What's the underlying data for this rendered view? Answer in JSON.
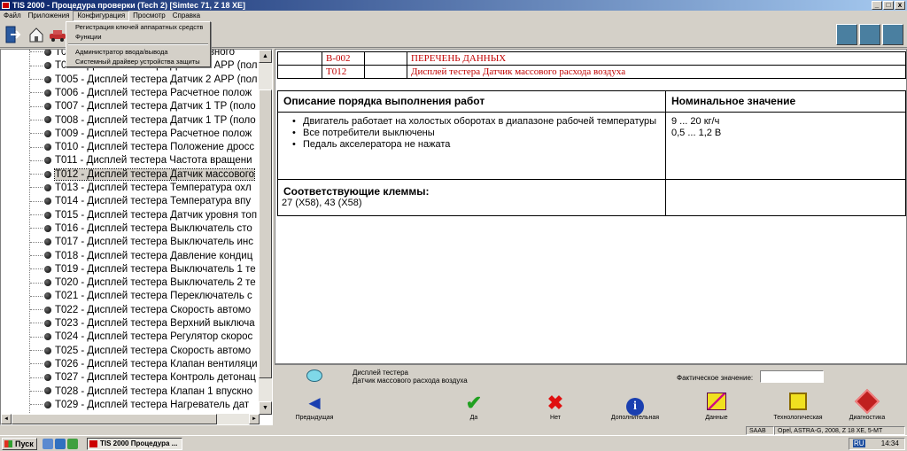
{
  "window": {
    "title": "TIS 2000 - Процедура проверки (Tech 2) [Simtec 71, Z 18 XE]",
    "buttons": [
      "_",
      "□",
      "x"
    ]
  },
  "menu": {
    "items": [
      "Файл",
      "Приложения",
      "Конфигурация",
      "Просмотр",
      "Справка"
    ],
    "open_menu": "Конфигурация",
    "dropdown": {
      "group1": [
        "Регистрация ключей аппаратных средств",
        "Функции"
      ],
      "group2": [
        "Администратор ввода/вывода",
        "Системный драйвер устройства защиты"
      ]
    }
  },
  "tree": {
    "items": [
      "T00... - Дисплей тестера ...топливного",
      "T004 - Дисплей тестера Датчик 1 APP (пол",
      "T005 - Дисплей тестера Датчик 2 APP (пол",
      "T006 - Дисплей тестера Расчетное полож",
      "T007 - Дисплей тестера Датчик 1 TP (поло",
      "T008 - Дисплей тестера Датчик 1 TP (поло",
      "T009 - Дисплей тестера Расчетное полож",
      "T010 - Дисплей тестера Положение дросс",
      "T011 - Дисплей тестера Частота вращени",
      "T012 - Дисплей тестера Датчик массового",
      "T013 - Дисплей тестера Температура охл",
      "T014 - Дисплей тестера Температура впу",
      "T015 - Дисплей тестера Датчик уровня топ",
      "T016 - Дисплей тестера Выключатель сто",
      "T017 - Дисплей тестера Выключатель инс",
      "T018 - Дисплей тестера Давление кондиц",
      "T019 - Дисплей тестера Выключатель 1 те",
      "T020 - Дисплей тестера Выключатель 2 те",
      "T021 - Дисплей тестера Переключатель с",
      "T022 - Дисплей тестера Скорость автомо",
      "T023 - Дисплей тестера Верхний выключа",
      "T024 - Дисплей тестера Регулятор скорос",
      "T025 - Дисплей тестера Скорость автомо",
      "T026 - Дисплей тестера Клапан вентиляци",
      "T027 - Дисплей тестера Контроль детонац",
      "T028 - Дисплей тестера Клапан 1 впускно",
      "T029 - Дисплей тестера Нагреватель дат"
    ],
    "selected_index": 9
  },
  "doc": {
    "code1": "B-002",
    "title1": "ПЕРЕЧЕНЬ ДАННЫХ",
    "code2": "T012",
    "title2": "Дисплей тестера Датчик массового расхода воздуха",
    "col_left_header": "Описание порядка выполнения работ",
    "col_right_header": "Номинальное значение",
    "bullets": [
      "Двигатель работает на холостых оборотах в диапазоне рабочей температуры",
      "Все потребители выключены",
      "Педаль акселератора не нажата"
    ],
    "nominal": [
      "9 ... 20 кг/ч",
      "0,5 ... 1,2 В"
    ],
    "clamps_header": "Соответствующие клеммы:",
    "clamps_value": "27 (X58), 43 (X58)"
  },
  "infobar": {
    "desc_line1": "Дисплей тестера",
    "desc_line2": "Датчик массового расхода воздуха",
    "actual_label": "Фактическое значение:",
    "actual_value": ""
  },
  "actions": [
    {
      "icon": "back-arrow",
      "label": "Предыдущая"
    },
    {
      "icon": "checkmark",
      "label": "Да"
    },
    {
      "icon": "cross",
      "label": "Нет"
    },
    {
      "icon": "info",
      "label": "Дополнительная"
    },
    {
      "icon": "chart",
      "label": "Данные"
    },
    {
      "icon": "note",
      "label": "Технологическая"
    },
    {
      "icon": "diagnostic",
      "label": "Диагностика"
    }
  ],
  "status": {
    "brand": "SAAB",
    "vehicle": "Opel, ASTRA-G, 2008, Z 18 XE, 5-MT"
  },
  "taskbar": {
    "start": "Пуск",
    "task": "TIS 2000 Процедура ...",
    "lang": "RU",
    "time": "14:34"
  },
  "colors": {
    "accent_red": "#c00000",
    "title_blue": "#0a246a"
  }
}
